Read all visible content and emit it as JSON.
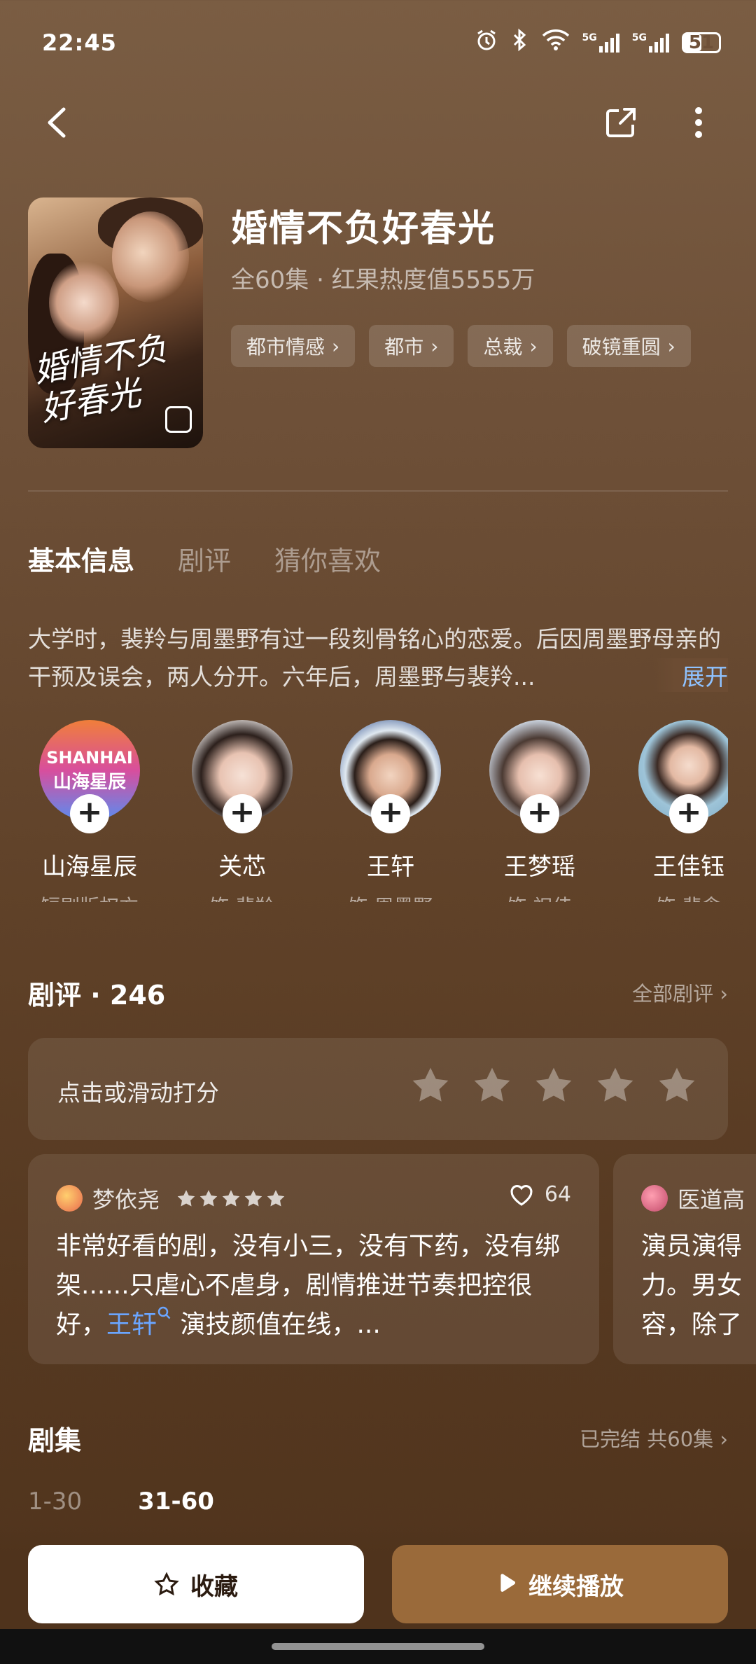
{
  "status_bar": {
    "time": "22:45",
    "battery": "51",
    "net1": "5G",
    "net2": "5G"
  },
  "show": {
    "title": "婚情不负好春光",
    "meta": "全60集 · 红果热度值5555万",
    "poster_text": "婚情不负好春光",
    "tags": [
      "都市情感",
      "都市",
      "总裁",
      "破镜重圆"
    ]
  },
  "tabs": [
    "基本信息",
    "剧评",
    "猜你喜欢"
  ],
  "synopsis": {
    "text": "大学时，裴羚与周墨野有过一段刻骨铭心的恋爱。后因周墨野母亲的干预及误会，两人分开。六年后，周墨野与裴羚...",
    "expand": "展开"
  },
  "cast": [
    {
      "name": "山海星辰",
      "role": "短剧版权方",
      "logo_top": "SHANHAI",
      "logo_bottom": "山海星辰"
    },
    {
      "name": "关芯",
      "role": "饰 裴羚"
    },
    {
      "name": "王轩",
      "role": "饰 周墨野"
    },
    {
      "name": "王梦瑶",
      "role": "饰 祝佳"
    },
    {
      "name": "王佳钰",
      "role": "饰 裴念"
    }
  ],
  "reviews_section": {
    "title": "剧评 · 246",
    "all_link": "全部剧评",
    "rate_prompt": "点击或滑动打分",
    "reviews": [
      {
        "user": "梦依尧",
        "rating": 5,
        "likes": "64",
        "text_before": "非常好看的剧，没有小三，没有下药，没有绑架......只虐心不虐身，剧情推进节奏把控很好，",
        "highlight": "王轩",
        "text_after": " 演技颜值在线，..."
      },
      {
        "user": "医道高",
        "text": "演员演得力。男女容，除了"
      }
    ]
  },
  "episodes_section": {
    "title": "剧集",
    "status_link": "已完结 共60集",
    "ranges": [
      "1-30",
      "31-60"
    ],
    "active_range": "31-60"
  },
  "actions": {
    "favorite": "收藏",
    "play": "继续播放"
  }
}
